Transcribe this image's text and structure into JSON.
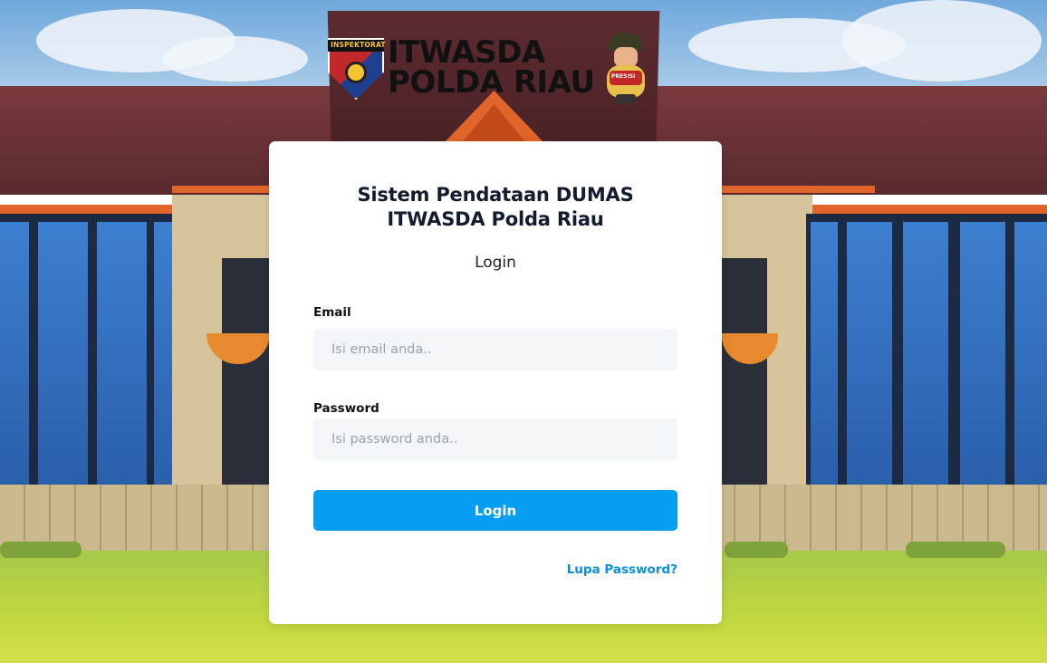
{
  "header": {
    "badge_text": "INSPEKTORAT",
    "brand_line1": "ITWASDA",
    "brand_line2": "POLDA RIAU",
    "mascot_text": "PRESISI"
  },
  "login": {
    "title_line1": "Sistem Pendataan DUMAS",
    "title_line2": "ITWASDA Polda Riau",
    "subtitle": "Login",
    "email_label": "Email",
    "email_placeholder": "Isi email anda..",
    "password_label": "Password",
    "password_placeholder": "Isi password anda..",
    "submit_label": "Login",
    "forgot_label": "Lupa Password?"
  },
  "colors": {
    "accent": "#069ef3",
    "link": "#0a8ee0",
    "input_bg": "#f3f6f9",
    "title": "#131b2e"
  },
  "icons": [
    "inspektorat-badge-logo",
    "police-mascot-logo"
  ]
}
